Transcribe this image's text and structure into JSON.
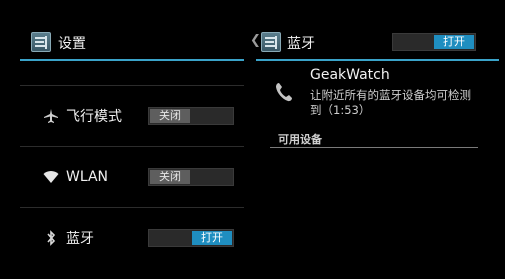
{
  "left": {
    "title": "设置",
    "items": [
      {
        "label": "飞行模式",
        "icon": "airplane-icon",
        "toggle": "关闭",
        "state": "off"
      },
      {
        "label": "WLAN",
        "icon": "wifi-icon",
        "toggle": "关闭",
        "state": "off"
      },
      {
        "label": "蓝牙",
        "icon": "bluetooth-icon",
        "toggle": "打开",
        "state": "on"
      }
    ]
  },
  "right": {
    "title": "蓝牙",
    "header_toggle": "打开",
    "device": {
      "name": "GeakWatch",
      "description": "让附近所有的蓝牙设备均可检测到（1:53）"
    },
    "section_title": "可用设备"
  },
  "colors": {
    "accent": "#3aa3c9",
    "toggle_on": "#1f8ec0",
    "toggle_off": "#5e5e5e"
  }
}
